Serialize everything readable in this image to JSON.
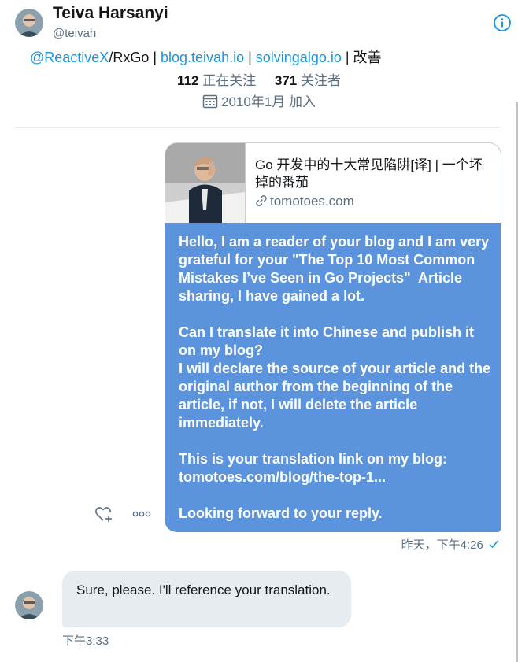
{
  "header": {
    "name": "Teiva Harsanyi",
    "handle": "@teivah",
    "info_icon": "info-icon"
  },
  "profile": {
    "bio_links": [
      "@ReactiveX",
      "blog.teivah.io",
      "solvingalgo.io"
    ],
    "bio_text_1": "/RxGo | ",
    "bio_sep": " | ",
    "bio_tail": " | 改善",
    "following_count": "112",
    "following_label": " 正在关注",
    "followers_count": "371",
    "followers_label": " 关注者",
    "joined": "2010年1月 加入",
    "calendar_icon": "calendar-icon"
  },
  "link_card": {
    "title": "Go 开发中的十大常见陷阱[译] | 一个坏掉的番茄",
    "domain": "tomotoes.com",
    "link_icon": "link-icon"
  },
  "outgoing_message": {
    "text_part1": "Hello, I am a reader of your blog and I am very grateful for your \"The Top 10 Most Common Mistakes I’ve Seen in Go Projects\"  Article sharing, I have gained a lot.\n\nCan I translate it into Chinese and publish it on my blog?\nI will declare the source of your article and the original author from the beginning of the article, if not, I will delete the article immediately.\n\nThis is your translation link on my blog:\n",
    "link": "tomotoes.com/blog/the-top-1...",
    "text_part2": "\n\nLooking forward to your reply.",
    "meta": "昨天，下午4:26",
    "status_icon": "check-icon"
  },
  "incoming_message": {
    "text": "Sure, please. I'll reference your translation.",
    "meta": "下午3:33"
  },
  "colors": {
    "accent": "#1b95e0",
    "outgoing_bubble": "#5b93dc",
    "incoming_bubble": "#e6ecf0"
  }
}
